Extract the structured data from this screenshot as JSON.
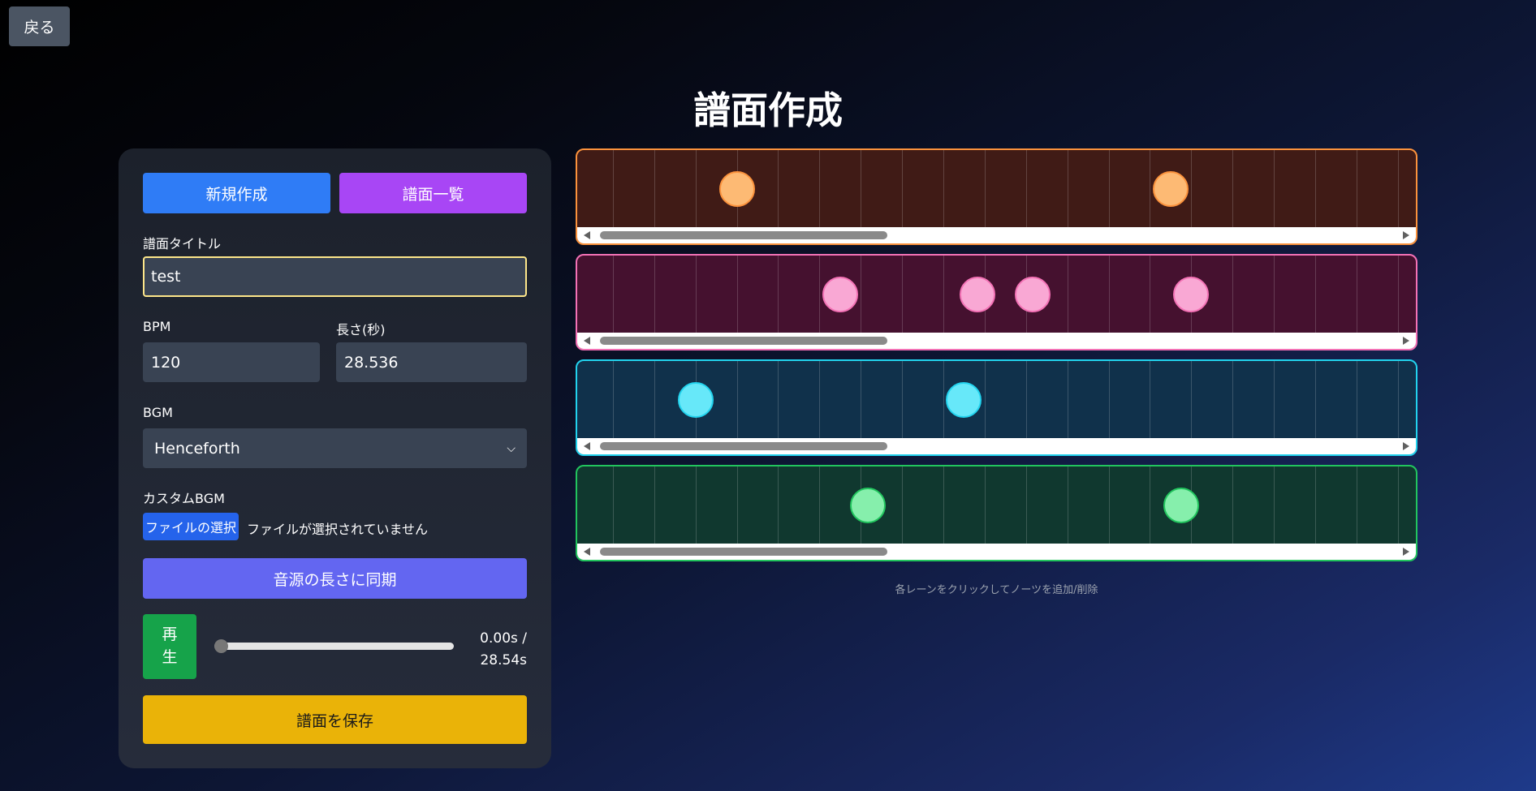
{
  "back_label": "戻る",
  "page_title": "譜面作成",
  "panel": {
    "new_label": "新規作成",
    "list_label": "譜面一覧",
    "title_label": "譜面タイトル",
    "title_value": "test",
    "bpm_label": "BPM",
    "bpm_value": "120",
    "length_label": "長さ(秒)",
    "length_value": "28.536",
    "bgm_label": "BGM",
    "bgm_selected": "Henceforth",
    "custom_bgm_label": "カスタムBGM",
    "file_button_label": "ファイルの選択",
    "file_status": "ファイルが選択されていません",
    "sync_label": "音源の長さに同期",
    "play_label": "再生",
    "time_current": "0.00s /",
    "time_total": "28.54s",
    "playback_fraction": 0.0,
    "save_label": "譜面を保存"
  },
  "lanes": [
    {
      "color": "#fb923c",
      "bg": "#401b16",
      "note_color": "#fdba74",
      "grid": "rgba(255,255,255,0.18)",
      "notes": [
        4,
        14.5
      ]
    },
    {
      "color": "#f472b6",
      "bg": "#45112f",
      "note_color": "#f9a8d4",
      "grid": "rgba(255,255,255,0.18)",
      "notes": [
        6.5,
        9.83,
        11.17,
        15
      ]
    },
    {
      "color": "#22d3ee",
      "bg": "#10314b",
      "note_color": "#67e8f9",
      "grid": "rgba(255,255,255,0.18)",
      "notes": [
        3,
        9.5
      ]
    },
    {
      "color": "#22c55e",
      "bg": "#10382f",
      "note_color": "#86efac",
      "grid": "rgba(255,255,255,0.18)",
      "notes": [
        7.17,
        14.75
      ]
    }
  ],
  "hint": "各レーンをクリックしてノーツを追加/削除"
}
